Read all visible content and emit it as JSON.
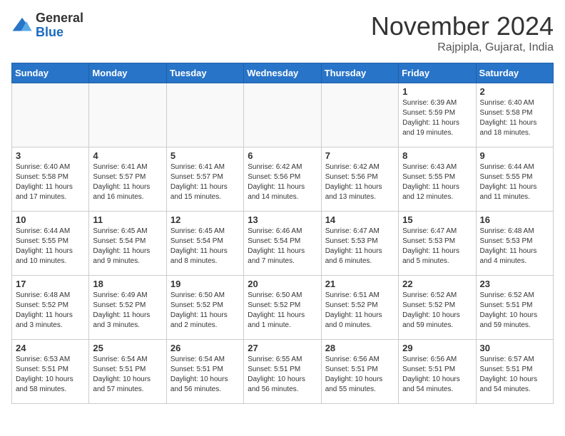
{
  "header": {
    "logo_general": "General",
    "logo_blue": "Blue",
    "month": "November 2024",
    "location": "Rajpipla, Gujarat, India"
  },
  "days_of_week": [
    "Sunday",
    "Monday",
    "Tuesday",
    "Wednesday",
    "Thursday",
    "Friday",
    "Saturday"
  ],
  "weeks": [
    [
      {
        "day": "",
        "empty": true
      },
      {
        "day": "",
        "empty": true
      },
      {
        "day": "",
        "empty": true
      },
      {
        "day": "",
        "empty": true
      },
      {
        "day": "",
        "empty": true
      },
      {
        "day": "1",
        "sunrise": "Sunrise: 6:39 AM",
        "sunset": "Sunset: 5:59 PM",
        "daylight": "Daylight: 11 hours and 19 minutes."
      },
      {
        "day": "2",
        "sunrise": "Sunrise: 6:40 AM",
        "sunset": "Sunset: 5:58 PM",
        "daylight": "Daylight: 11 hours and 18 minutes."
      }
    ],
    [
      {
        "day": "3",
        "sunrise": "Sunrise: 6:40 AM",
        "sunset": "Sunset: 5:58 PM",
        "daylight": "Daylight: 11 hours and 17 minutes."
      },
      {
        "day": "4",
        "sunrise": "Sunrise: 6:41 AM",
        "sunset": "Sunset: 5:57 PM",
        "daylight": "Daylight: 11 hours and 16 minutes."
      },
      {
        "day": "5",
        "sunrise": "Sunrise: 6:41 AM",
        "sunset": "Sunset: 5:57 PM",
        "daylight": "Daylight: 11 hours and 15 minutes."
      },
      {
        "day": "6",
        "sunrise": "Sunrise: 6:42 AM",
        "sunset": "Sunset: 5:56 PM",
        "daylight": "Daylight: 11 hours and 14 minutes."
      },
      {
        "day": "7",
        "sunrise": "Sunrise: 6:42 AM",
        "sunset": "Sunset: 5:56 PM",
        "daylight": "Daylight: 11 hours and 13 minutes."
      },
      {
        "day": "8",
        "sunrise": "Sunrise: 6:43 AM",
        "sunset": "Sunset: 5:55 PM",
        "daylight": "Daylight: 11 hours and 12 minutes."
      },
      {
        "day": "9",
        "sunrise": "Sunrise: 6:44 AM",
        "sunset": "Sunset: 5:55 PM",
        "daylight": "Daylight: 11 hours and 11 minutes."
      }
    ],
    [
      {
        "day": "10",
        "sunrise": "Sunrise: 6:44 AM",
        "sunset": "Sunset: 5:55 PM",
        "daylight": "Daylight: 11 hours and 10 minutes."
      },
      {
        "day": "11",
        "sunrise": "Sunrise: 6:45 AM",
        "sunset": "Sunset: 5:54 PM",
        "daylight": "Daylight: 11 hours and 9 minutes."
      },
      {
        "day": "12",
        "sunrise": "Sunrise: 6:45 AM",
        "sunset": "Sunset: 5:54 PM",
        "daylight": "Daylight: 11 hours and 8 minutes."
      },
      {
        "day": "13",
        "sunrise": "Sunrise: 6:46 AM",
        "sunset": "Sunset: 5:54 PM",
        "daylight": "Daylight: 11 hours and 7 minutes."
      },
      {
        "day": "14",
        "sunrise": "Sunrise: 6:47 AM",
        "sunset": "Sunset: 5:53 PM",
        "daylight": "Daylight: 11 hours and 6 minutes."
      },
      {
        "day": "15",
        "sunrise": "Sunrise: 6:47 AM",
        "sunset": "Sunset: 5:53 PM",
        "daylight": "Daylight: 11 hours and 5 minutes."
      },
      {
        "day": "16",
        "sunrise": "Sunrise: 6:48 AM",
        "sunset": "Sunset: 5:53 PM",
        "daylight": "Daylight: 11 hours and 4 minutes."
      }
    ],
    [
      {
        "day": "17",
        "sunrise": "Sunrise: 6:48 AM",
        "sunset": "Sunset: 5:52 PM",
        "daylight": "Daylight: 11 hours and 3 minutes."
      },
      {
        "day": "18",
        "sunrise": "Sunrise: 6:49 AM",
        "sunset": "Sunset: 5:52 PM",
        "daylight": "Daylight: 11 hours and 3 minutes."
      },
      {
        "day": "19",
        "sunrise": "Sunrise: 6:50 AM",
        "sunset": "Sunset: 5:52 PM",
        "daylight": "Daylight: 11 hours and 2 minutes."
      },
      {
        "day": "20",
        "sunrise": "Sunrise: 6:50 AM",
        "sunset": "Sunset: 5:52 PM",
        "daylight": "Daylight: 11 hours and 1 minute."
      },
      {
        "day": "21",
        "sunrise": "Sunrise: 6:51 AM",
        "sunset": "Sunset: 5:52 PM",
        "daylight": "Daylight: 11 hours and 0 minutes."
      },
      {
        "day": "22",
        "sunrise": "Sunrise: 6:52 AM",
        "sunset": "Sunset: 5:52 PM",
        "daylight": "Daylight: 10 hours and 59 minutes."
      },
      {
        "day": "23",
        "sunrise": "Sunrise: 6:52 AM",
        "sunset": "Sunset: 5:51 PM",
        "daylight": "Daylight: 10 hours and 59 minutes."
      }
    ],
    [
      {
        "day": "24",
        "sunrise": "Sunrise: 6:53 AM",
        "sunset": "Sunset: 5:51 PM",
        "daylight": "Daylight: 10 hours and 58 minutes."
      },
      {
        "day": "25",
        "sunrise": "Sunrise: 6:54 AM",
        "sunset": "Sunset: 5:51 PM",
        "daylight": "Daylight: 10 hours and 57 minutes."
      },
      {
        "day": "26",
        "sunrise": "Sunrise: 6:54 AM",
        "sunset": "Sunset: 5:51 PM",
        "daylight": "Daylight: 10 hours and 56 minutes."
      },
      {
        "day": "27",
        "sunrise": "Sunrise: 6:55 AM",
        "sunset": "Sunset: 5:51 PM",
        "daylight": "Daylight: 10 hours and 56 minutes."
      },
      {
        "day": "28",
        "sunrise": "Sunrise: 6:56 AM",
        "sunset": "Sunset: 5:51 PM",
        "daylight": "Daylight: 10 hours and 55 minutes."
      },
      {
        "day": "29",
        "sunrise": "Sunrise: 6:56 AM",
        "sunset": "Sunset: 5:51 PM",
        "daylight": "Daylight: 10 hours and 54 minutes."
      },
      {
        "day": "30",
        "sunrise": "Sunrise: 6:57 AM",
        "sunset": "Sunset: 5:51 PM",
        "daylight": "Daylight: 10 hours and 54 minutes."
      }
    ]
  ]
}
